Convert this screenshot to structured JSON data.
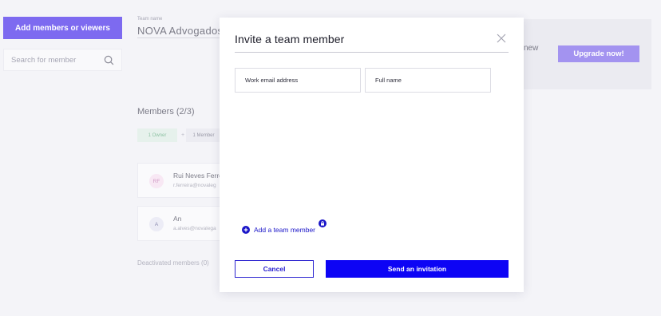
{
  "sidebar": {
    "add_button_label": "Add members or viewers",
    "search_placeholder": "Search for member"
  },
  "team": {
    "name_label": "Team name",
    "name_value": "NOVA Advogados"
  },
  "upgrade": {
    "text": "new",
    "button_label": "Upgrade now!"
  },
  "members": {
    "title": "Members (2/3)",
    "badges": {
      "owner": "1 Owner",
      "separator": "+",
      "member": "1 Member"
    },
    "list": [
      {
        "initials": "RF",
        "name": "Rui Neves Ferre",
        "email": "r.ferreira@novaleg"
      },
      {
        "initials": "A",
        "name": "An",
        "email": "a.alves@novalega"
      }
    ],
    "deactivated": "Deactivated members (0)"
  },
  "modal": {
    "title": "Invite a team member",
    "email_placeholder": "Work email address",
    "name_placeholder": "Full name",
    "add_member_label": "Add a team member",
    "cancel_label": "Cancel",
    "send_label": "Send an invitation"
  },
  "colors": {
    "primary": "#0d04f5",
    "accent_purple": "#7d6af0",
    "upgrade_purple": "#a393f0"
  }
}
